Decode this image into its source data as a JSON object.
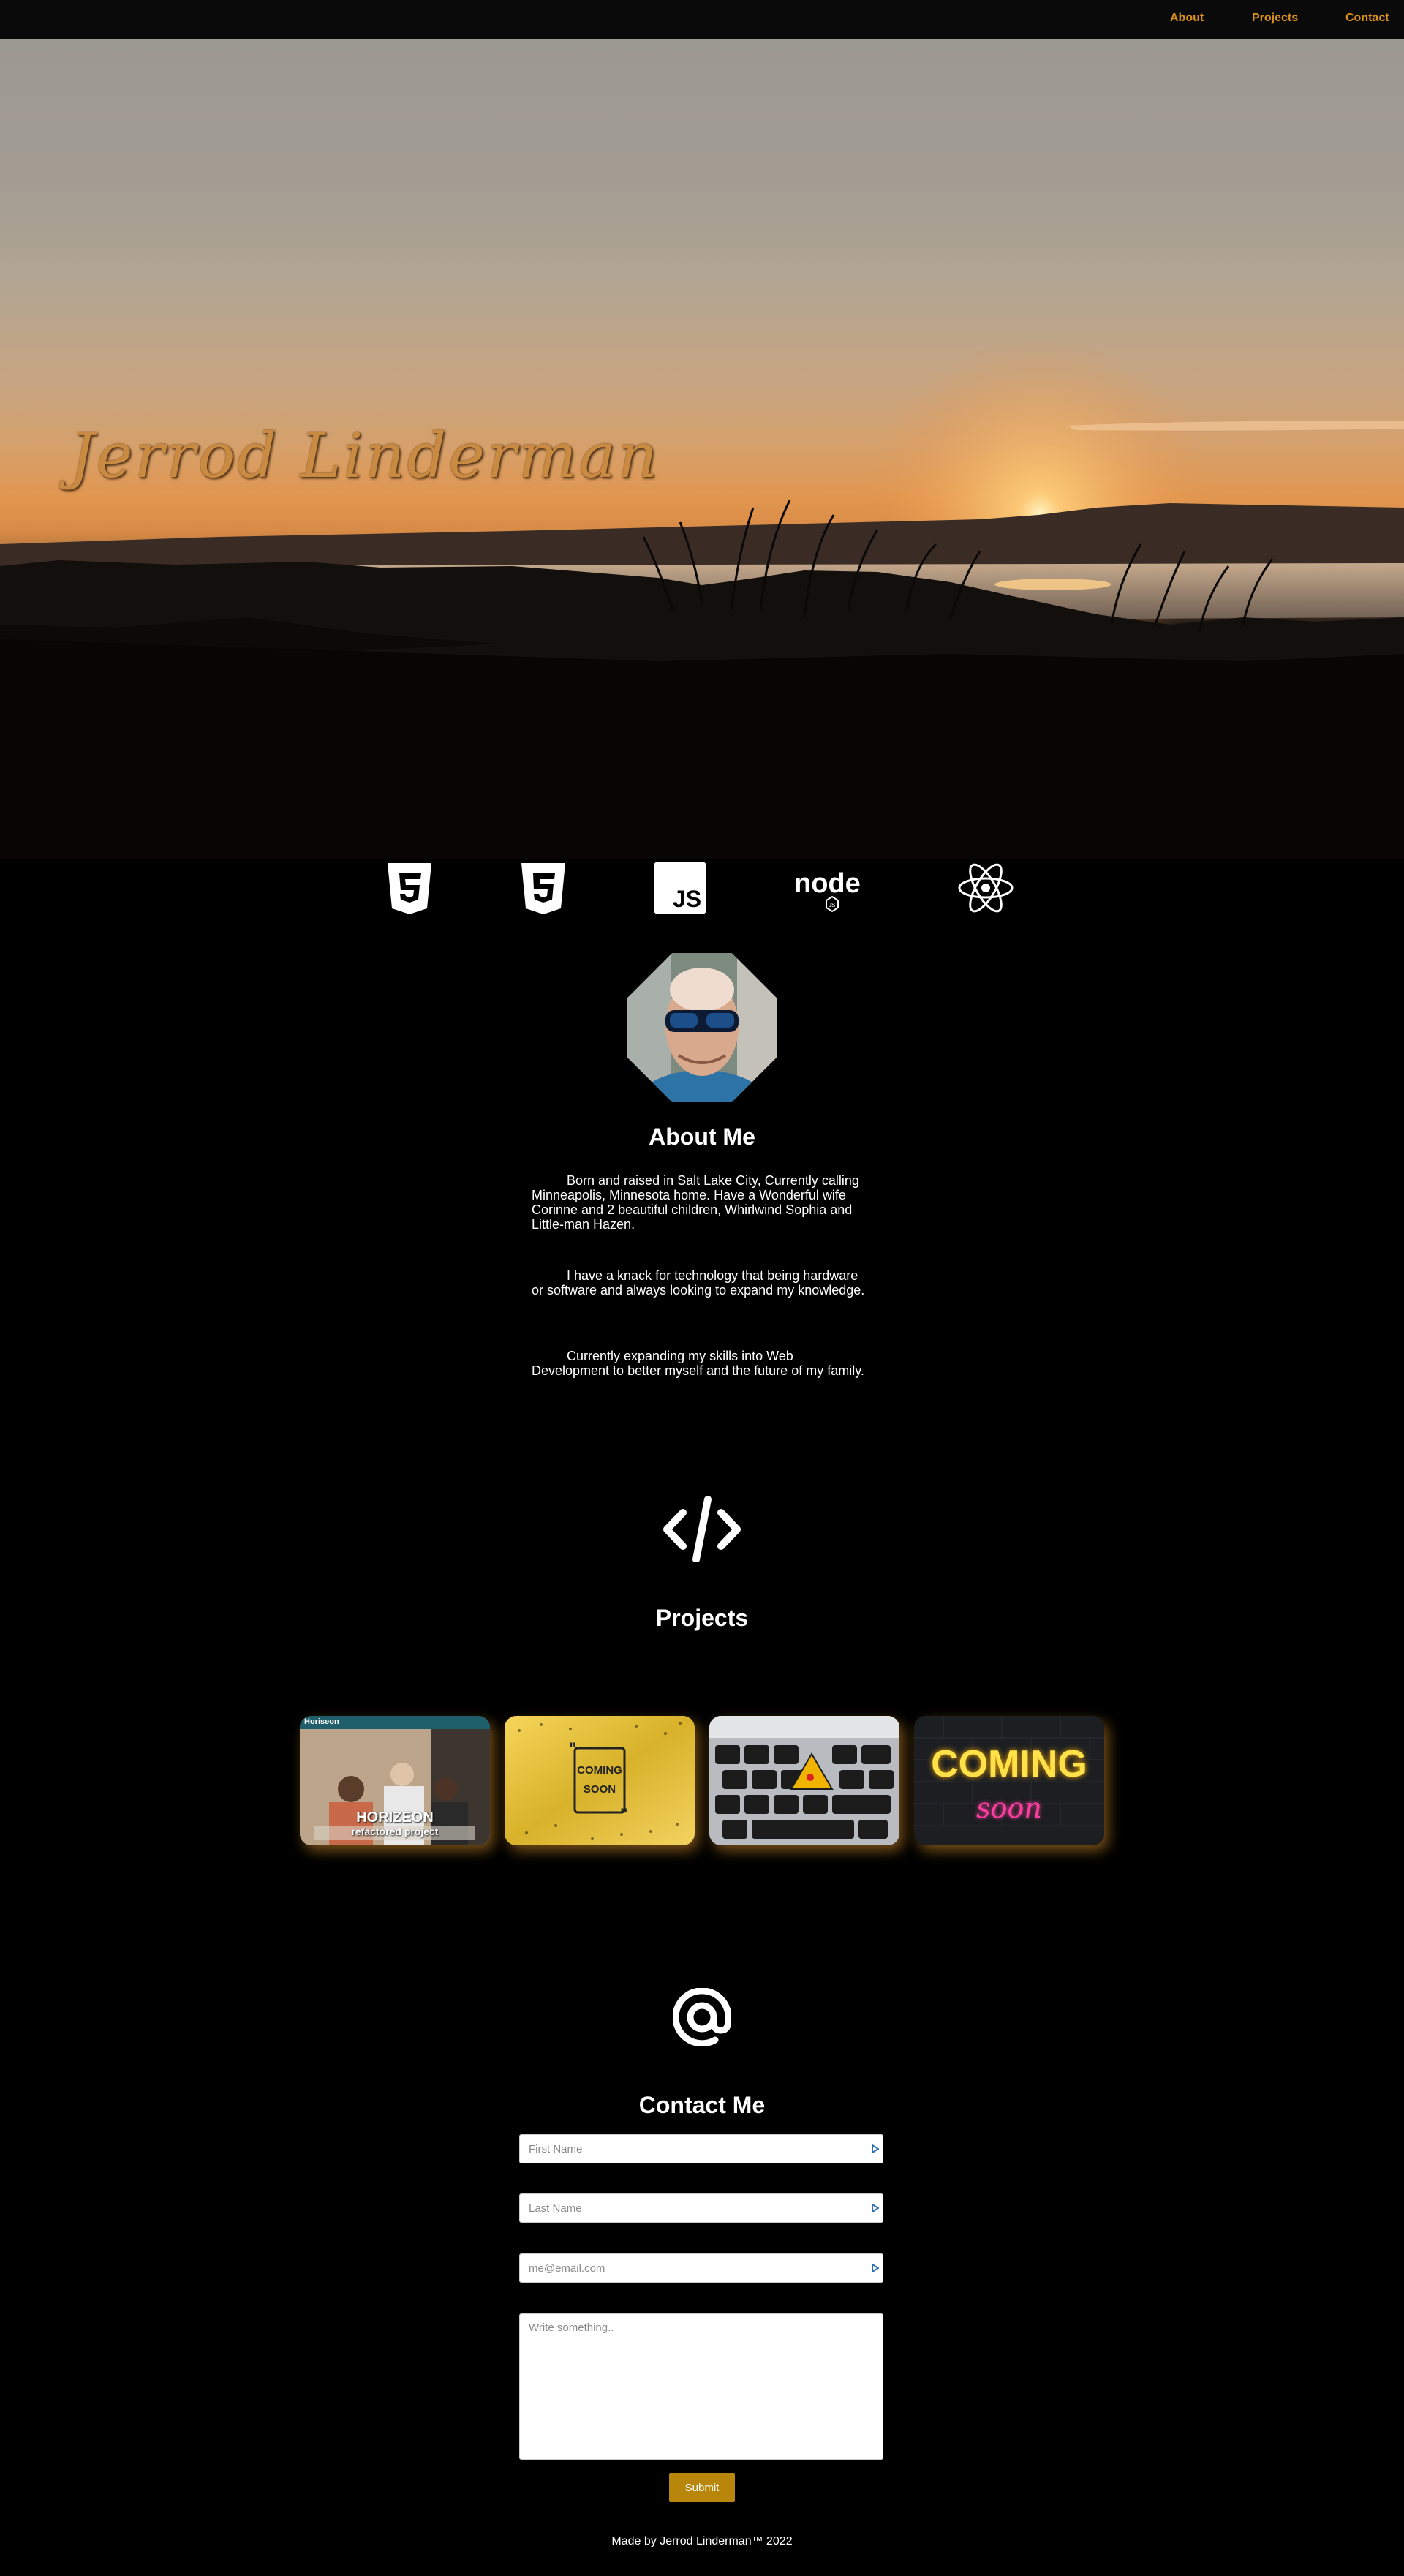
{
  "nav": {
    "about": "About",
    "projects": "Projects",
    "contact": "Contact",
    "color": "#d9901b"
  },
  "hero": {
    "title": "Jerrod Linderman"
  },
  "tech_icons": [
    "html5-icon",
    "css3-icon",
    "javascript-icon",
    "nodejs-icon",
    "react-icon"
  ],
  "about": {
    "heading": "About Me",
    "paragraphs": [
      "Born and raised in Salt Lake City, Currently calling Minneapolis, Minnesota home. Have a Wonderful wife Corinne and 2 beautiful children, Whirlwind Sophia and Little-man Hazen.",
      "I have a knack for technology that being hardware or software and always looking to expand my knowledge.",
      "Currently expanding my skills into Web Development to better myself and the future of my family."
    ]
  },
  "projects": {
    "heading": "Projects",
    "cards": [
      {
        "brand": "Horiseon",
        "title": "HORIZEON",
        "subtitle": "refactored project"
      },
      {
        "title": "COMING",
        "subtitle": "SOON"
      },
      {
        "title": ""
      },
      {
        "title": "COMING",
        "subtitle": "soon"
      }
    ]
  },
  "contact": {
    "heading": "Contact Me",
    "first_name_placeholder": "First Name",
    "last_name_placeholder": "Last Name",
    "email_placeholder": "me@email.com",
    "message_placeholder": "Write something..",
    "submit_label": "Submit",
    "accent": "#b8860b"
  },
  "footer": {
    "text": "Made by Jerrod Linderman™ 2022"
  }
}
